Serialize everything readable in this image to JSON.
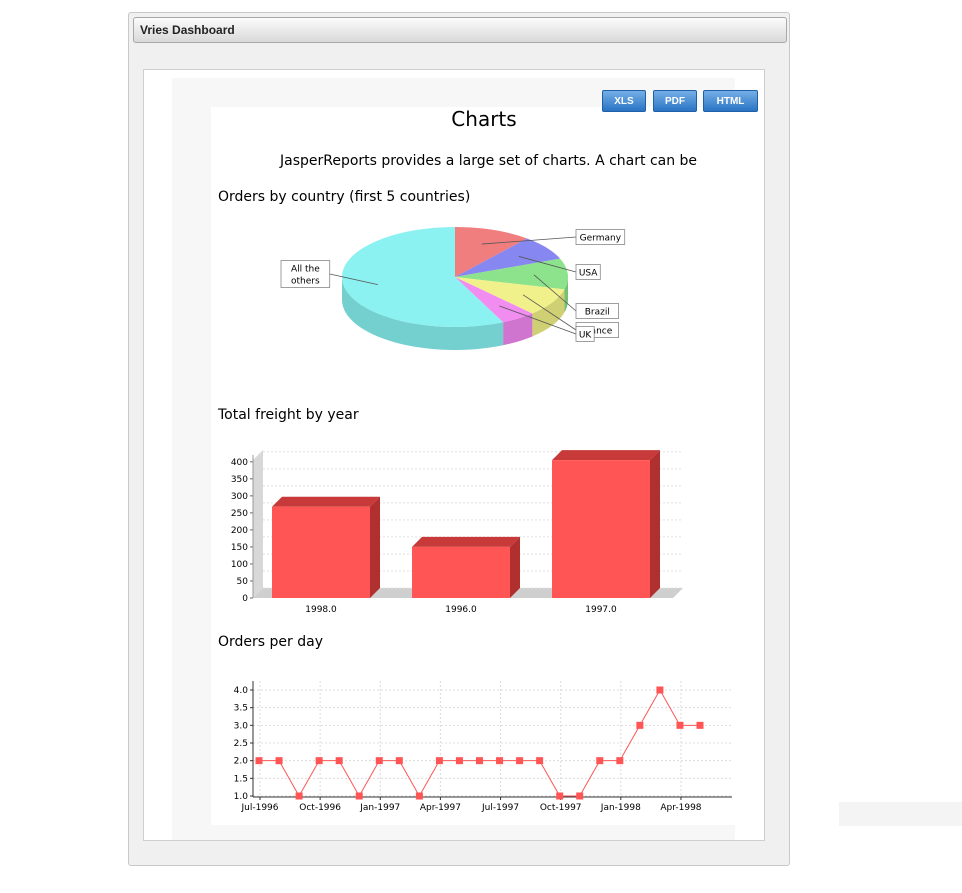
{
  "window": {
    "title": "Vries Dashboard"
  },
  "export_buttons": [
    "XLS",
    "PDF",
    "HTML"
  ],
  "report": {
    "title": "Charts",
    "description": "JasperReports provides a large set of charts. A chart can be"
  },
  "sections": {
    "pie": "Orders by country (first 5 countries)",
    "bar": "Total freight by year",
    "line": "Orders per day"
  },
  "chart_data": [
    {
      "type": "pie",
      "title": "Orders by country (first 5 countries)",
      "categories": [
        "Germany",
        "USA",
        "Brazil",
        "France",
        "UK",
        "All the others"
      ],
      "values": [
        11,
        8,
        10,
        9,
        5,
        57
      ],
      "colors": [
        "#f07070",
        "#7a7af0",
        "#80e080",
        "#f0f080",
        "#f080f0",
        "#80f0f0"
      ]
    },
    {
      "type": "bar",
      "title": "Total freight by year",
      "categories": [
        "1998.0",
        "1996.0",
        "1997.0"
      ],
      "values": [
        268,
        150,
        405
      ],
      "ylim": [
        0,
        400
      ],
      "yticks": [
        0,
        50,
        100,
        150,
        200,
        250,
        300,
        350,
        400
      ],
      "color": "#ff5555"
    },
    {
      "type": "line",
      "title": "Orders per day",
      "x_tick_labels": [
        "Jul-1996",
        "Oct-1996",
        "Jan-1997",
        "Apr-1997",
        "Jul-1997",
        "Oct-1997",
        "Jan-1998",
        "Apr-1998"
      ],
      "values": [
        2,
        2,
        1,
        2,
        2,
        1,
        2,
        2,
        1,
        2,
        2,
        2,
        2,
        2,
        2,
        1,
        1,
        2,
        2,
        3,
        4,
        3,
        3
      ],
      "ylim": [
        1.0,
        4.0
      ],
      "yticks": [
        "1.0",
        "1.5",
        "2.0",
        "2.5",
        "3.0",
        "3.5",
        "4.0"
      ],
      "color": "#ff5555"
    }
  ]
}
